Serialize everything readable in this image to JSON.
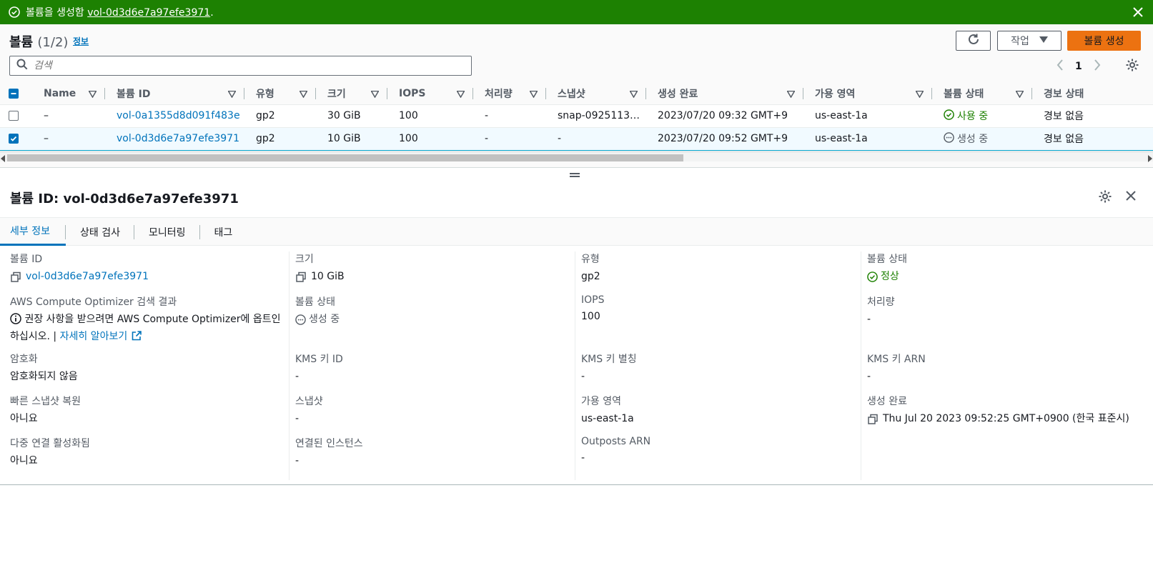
{
  "flash": {
    "message_prefix": "볼륨을 생성함 ",
    "volume_link": "vol-0d3d6e7a97efe3971",
    "message_suffix": "."
  },
  "list": {
    "title": "볼륨",
    "count": "(1/2)",
    "info_link": "정보",
    "actions_label": "작업",
    "create_label": "볼륨 생성",
    "search_placeholder": "검색",
    "page": "1",
    "columns": [
      "Name",
      "볼륨 ID",
      "유형",
      "크기",
      "IOPS",
      "처리량",
      "스냅샷",
      "생성 완료",
      "가용 영역",
      "볼륨 상태",
      "경보 상태"
    ],
    "rows": [
      {
        "selected": false,
        "name": "–",
        "volume_id": "vol-0a1355d8d091f483e",
        "type": "gp2",
        "size": "30 GiB",
        "iops": "100",
        "throughput": "-",
        "snapshot": "snap-0925113…",
        "created": "2023/07/20 09:32 GMT+9",
        "az": "us-east-1a",
        "state": "사용 중",
        "alarm": "경보 없음"
      },
      {
        "selected": true,
        "name": "–",
        "volume_id": "vol-0d3d6e7a97efe3971",
        "type": "gp2",
        "size": "10 GiB",
        "iops": "100",
        "throughput": "-",
        "snapshot": "-",
        "created": "2023/07/20 09:52 GMT+9",
        "az": "us-east-1a",
        "state": "생성 중",
        "alarm": "경보 없음"
      }
    ]
  },
  "detail": {
    "title": "볼륨 ID: vol-0d3d6e7a97efe3971",
    "tabs": [
      "세부 정보",
      "상태 검사",
      "모니터링",
      "태그"
    ],
    "fields": {
      "volume_id_label": "볼륨 ID",
      "volume_id_value": "vol-0d3d6e7a97efe3971",
      "size_label": "크기",
      "size_value": "10 GiB",
      "type_label": "유형",
      "type_value": "gp2",
      "state_label": "볼륨 상태",
      "state_value": "정상",
      "optimizer_label": "AWS Compute Optimizer 검색 결과",
      "optimizer_text": "권장 사항을 받으려면 AWS Compute Optimizer에 옵트인하십시오. |",
      "optimizer_link": "자세히 알아보기",
      "volume_state_label": "볼륨 상태",
      "volume_state_value": "생성 중",
      "iops_label": "IOPS",
      "iops_value": "100",
      "throughput_label": "처리량",
      "throughput_value": "-",
      "encryption_label": "암호화",
      "encryption_value": "암호화되지 않음",
      "kms_id_label": "KMS 키 ID",
      "kms_id_value": "-",
      "kms_alias_label": "KMS 키 별칭",
      "kms_alias_value": "-",
      "kms_arn_label": "KMS 키 ARN",
      "kms_arn_value": "-",
      "fast_restore_label": "빠른 스냅샷 복원",
      "fast_restore_value": "아니요",
      "snapshot_label": "스냅샷",
      "snapshot_value": "-",
      "az_label": "가용 영역",
      "az_value": "us-east-1a",
      "created_label": "생성 완료",
      "created_value": "Thu Jul 20 2023 09:52:25 GMT+0900 (한국 표준시)",
      "multi_attach_label": "다중 연결 활성화됨",
      "multi_attach_value": "아니요",
      "instances_label": "연결된 인스턴스",
      "instances_value": "-",
      "outposts_label": "Outposts ARN",
      "outposts_value": "-"
    }
  },
  "colors": {
    "success": "#1d8102",
    "link": "#0073bb",
    "primary": "#ec7211"
  }
}
